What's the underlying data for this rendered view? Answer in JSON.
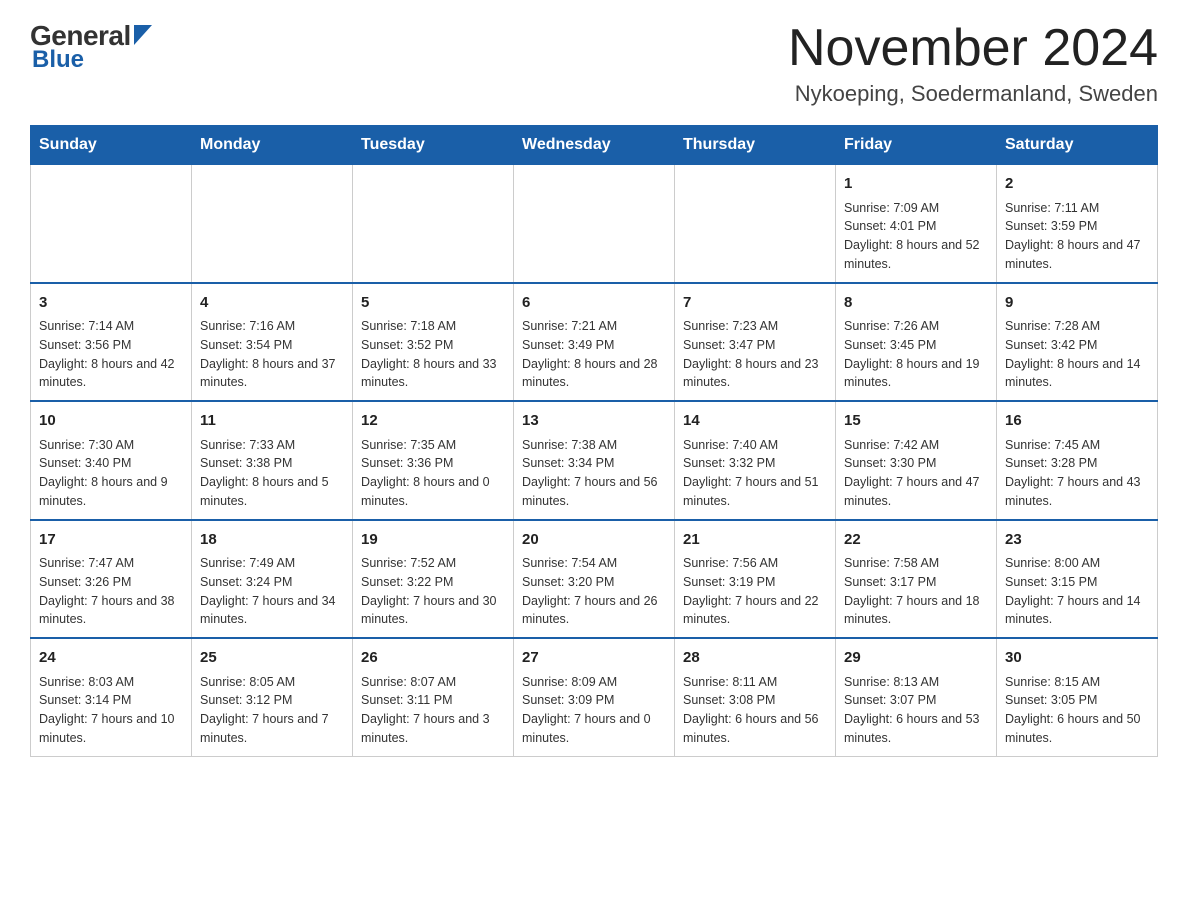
{
  "logo": {
    "general": "General",
    "blue": "Blue"
  },
  "title": "November 2024",
  "subtitle": "Nykoeping, Soedermanland, Sweden",
  "days_of_week": [
    "Sunday",
    "Monday",
    "Tuesday",
    "Wednesday",
    "Thursday",
    "Friday",
    "Saturday"
  ],
  "weeks": [
    [
      {
        "day": "",
        "sunrise": "",
        "sunset": "",
        "daylight": ""
      },
      {
        "day": "",
        "sunrise": "",
        "sunset": "",
        "daylight": ""
      },
      {
        "day": "",
        "sunrise": "",
        "sunset": "",
        "daylight": ""
      },
      {
        "day": "",
        "sunrise": "",
        "sunset": "",
        "daylight": ""
      },
      {
        "day": "",
        "sunrise": "",
        "sunset": "",
        "daylight": ""
      },
      {
        "day": "1",
        "sunrise": "Sunrise: 7:09 AM",
        "sunset": "Sunset: 4:01 PM",
        "daylight": "Daylight: 8 hours and 52 minutes."
      },
      {
        "day": "2",
        "sunrise": "Sunrise: 7:11 AM",
        "sunset": "Sunset: 3:59 PM",
        "daylight": "Daylight: 8 hours and 47 minutes."
      }
    ],
    [
      {
        "day": "3",
        "sunrise": "Sunrise: 7:14 AM",
        "sunset": "Sunset: 3:56 PM",
        "daylight": "Daylight: 8 hours and 42 minutes."
      },
      {
        "day": "4",
        "sunrise": "Sunrise: 7:16 AM",
        "sunset": "Sunset: 3:54 PM",
        "daylight": "Daylight: 8 hours and 37 minutes."
      },
      {
        "day": "5",
        "sunrise": "Sunrise: 7:18 AM",
        "sunset": "Sunset: 3:52 PM",
        "daylight": "Daylight: 8 hours and 33 minutes."
      },
      {
        "day": "6",
        "sunrise": "Sunrise: 7:21 AM",
        "sunset": "Sunset: 3:49 PM",
        "daylight": "Daylight: 8 hours and 28 minutes."
      },
      {
        "day": "7",
        "sunrise": "Sunrise: 7:23 AM",
        "sunset": "Sunset: 3:47 PM",
        "daylight": "Daylight: 8 hours and 23 minutes."
      },
      {
        "day": "8",
        "sunrise": "Sunrise: 7:26 AM",
        "sunset": "Sunset: 3:45 PM",
        "daylight": "Daylight: 8 hours and 19 minutes."
      },
      {
        "day": "9",
        "sunrise": "Sunrise: 7:28 AM",
        "sunset": "Sunset: 3:42 PM",
        "daylight": "Daylight: 8 hours and 14 minutes."
      }
    ],
    [
      {
        "day": "10",
        "sunrise": "Sunrise: 7:30 AM",
        "sunset": "Sunset: 3:40 PM",
        "daylight": "Daylight: 8 hours and 9 minutes."
      },
      {
        "day": "11",
        "sunrise": "Sunrise: 7:33 AM",
        "sunset": "Sunset: 3:38 PM",
        "daylight": "Daylight: 8 hours and 5 minutes."
      },
      {
        "day": "12",
        "sunrise": "Sunrise: 7:35 AM",
        "sunset": "Sunset: 3:36 PM",
        "daylight": "Daylight: 8 hours and 0 minutes."
      },
      {
        "day": "13",
        "sunrise": "Sunrise: 7:38 AM",
        "sunset": "Sunset: 3:34 PM",
        "daylight": "Daylight: 7 hours and 56 minutes."
      },
      {
        "day": "14",
        "sunrise": "Sunrise: 7:40 AM",
        "sunset": "Sunset: 3:32 PM",
        "daylight": "Daylight: 7 hours and 51 minutes."
      },
      {
        "day": "15",
        "sunrise": "Sunrise: 7:42 AM",
        "sunset": "Sunset: 3:30 PM",
        "daylight": "Daylight: 7 hours and 47 minutes."
      },
      {
        "day": "16",
        "sunrise": "Sunrise: 7:45 AM",
        "sunset": "Sunset: 3:28 PM",
        "daylight": "Daylight: 7 hours and 43 minutes."
      }
    ],
    [
      {
        "day": "17",
        "sunrise": "Sunrise: 7:47 AM",
        "sunset": "Sunset: 3:26 PM",
        "daylight": "Daylight: 7 hours and 38 minutes."
      },
      {
        "day": "18",
        "sunrise": "Sunrise: 7:49 AM",
        "sunset": "Sunset: 3:24 PM",
        "daylight": "Daylight: 7 hours and 34 minutes."
      },
      {
        "day": "19",
        "sunrise": "Sunrise: 7:52 AM",
        "sunset": "Sunset: 3:22 PM",
        "daylight": "Daylight: 7 hours and 30 minutes."
      },
      {
        "day": "20",
        "sunrise": "Sunrise: 7:54 AM",
        "sunset": "Sunset: 3:20 PM",
        "daylight": "Daylight: 7 hours and 26 minutes."
      },
      {
        "day": "21",
        "sunrise": "Sunrise: 7:56 AM",
        "sunset": "Sunset: 3:19 PM",
        "daylight": "Daylight: 7 hours and 22 minutes."
      },
      {
        "day": "22",
        "sunrise": "Sunrise: 7:58 AM",
        "sunset": "Sunset: 3:17 PM",
        "daylight": "Daylight: 7 hours and 18 minutes."
      },
      {
        "day": "23",
        "sunrise": "Sunrise: 8:00 AM",
        "sunset": "Sunset: 3:15 PM",
        "daylight": "Daylight: 7 hours and 14 minutes."
      }
    ],
    [
      {
        "day": "24",
        "sunrise": "Sunrise: 8:03 AM",
        "sunset": "Sunset: 3:14 PM",
        "daylight": "Daylight: 7 hours and 10 minutes."
      },
      {
        "day": "25",
        "sunrise": "Sunrise: 8:05 AM",
        "sunset": "Sunset: 3:12 PM",
        "daylight": "Daylight: 7 hours and 7 minutes."
      },
      {
        "day": "26",
        "sunrise": "Sunrise: 8:07 AM",
        "sunset": "Sunset: 3:11 PM",
        "daylight": "Daylight: 7 hours and 3 minutes."
      },
      {
        "day": "27",
        "sunrise": "Sunrise: 8:09 AM",
        "sunset": "Sunset: 3:09 PM",
        "daylight": "Daylight: 7 hours and 0 minutes."
      },
      {
        "day": "28",
        "sunrise": "Sunrise: 8:11 AM",
        "sunset": "Sunset: 3:08 PM",
        "daylight": "Daylight: 6 hours and 56 minutes."
      },
      {
        "day": "29",
        "sunrise": "Sunrise: 8:13 AM",
        "sunset": "Sunset: 3:07 PM",
        "daylight": "Daylight: 6 hours and 53 minutes."
      },
      {
        "day": "30",
        "sunrise": "Sunrise: 8:15 AM",
        "sunset": "Sunset: 3:05 PM",
        "daylight": "Daylight: 6 hours and 50 minutes."
      }
    ]
  ]
}
